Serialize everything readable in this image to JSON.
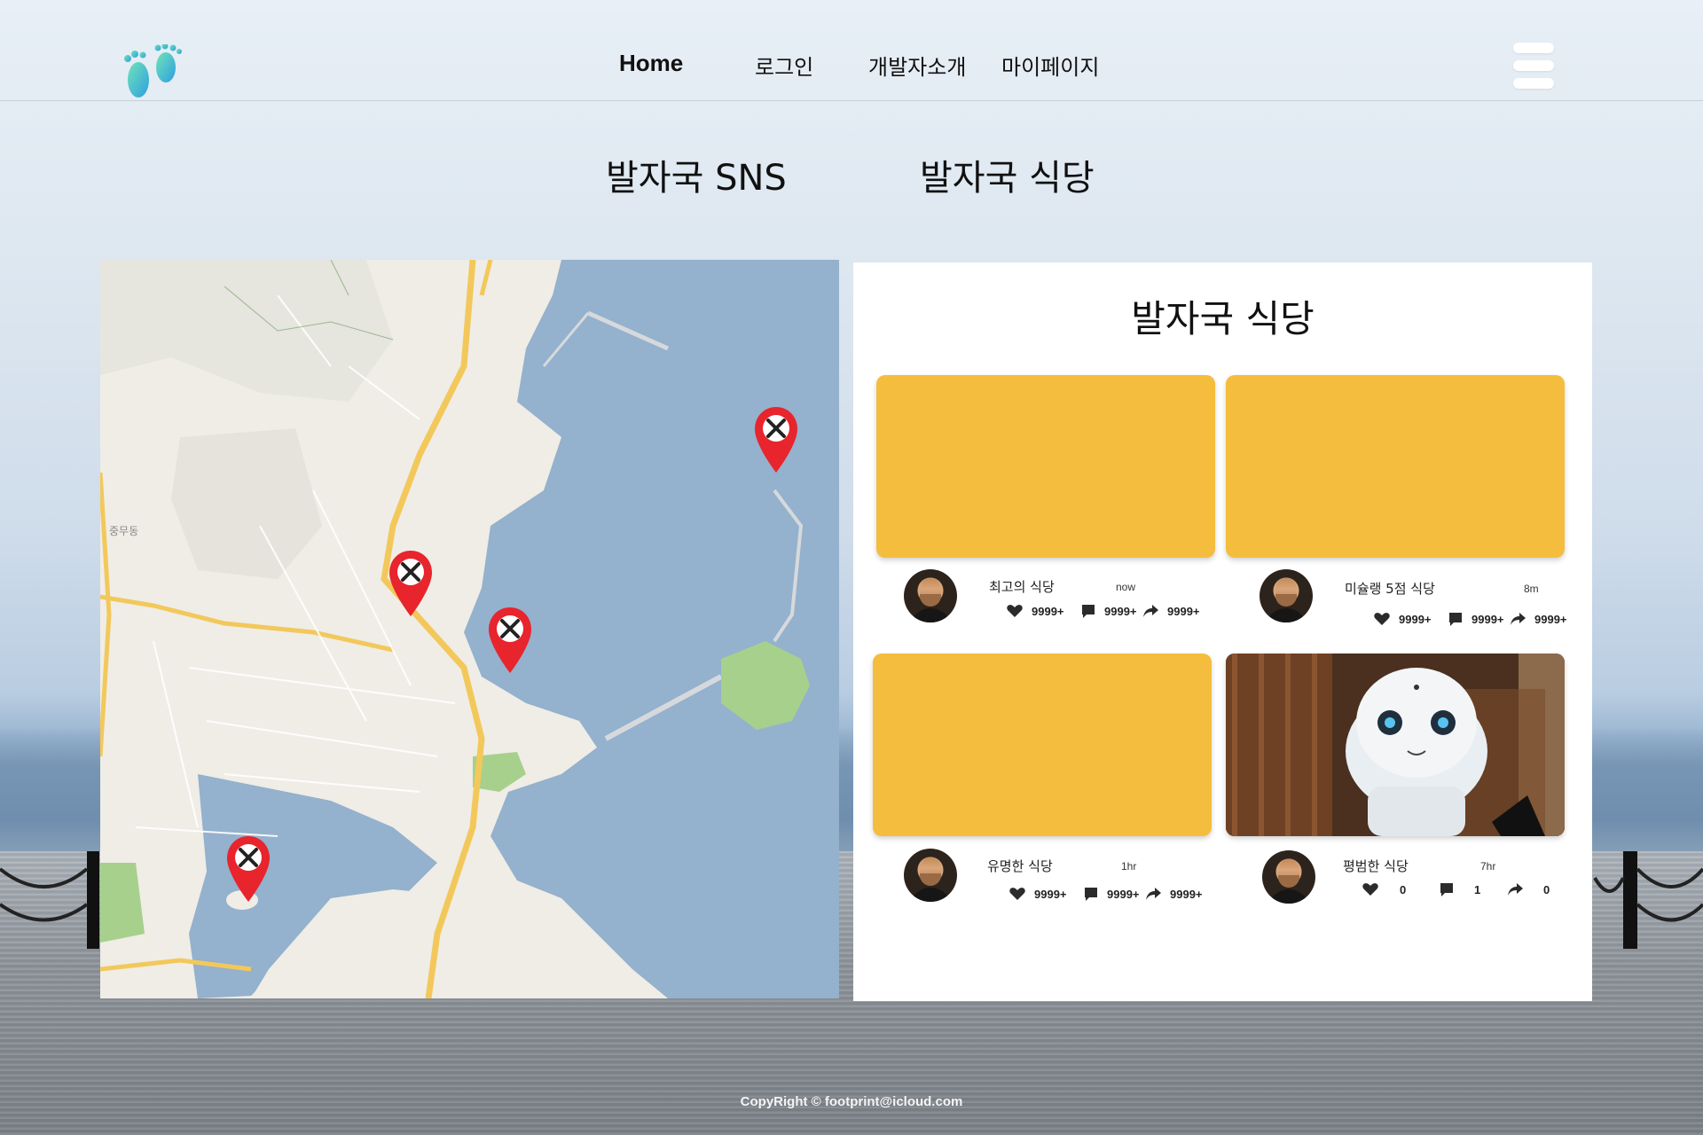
{
  "nav": {
    "home": "Home",
    "login": "로그인",
    "developer": "개발자소개",
    "mypage": "마이페이지"
  },
  "sections": {
    "sns": "발자국 SNS",
    "restaurant": "발자국 식당"
  },
  "panel": {
    "title": "발자국 식당",
    "cards": [
      {
        "name": "최고의 식당",
        "time": "now",
        "likes": "9999+",
        "comments": "9999+",
        "shares": "9999+"
      },
      {
        "name": "미슐랭 5점 식당",
        "time": "8m",
        "likes": "9999+",
        "comments": "9999+",
        "shares": "9999+"
      },
      {
        "name": "유명한 식당",
        "time": "1hr",
        "likes": "9999+",
        "comments": "9999+",
        "shares": "9999+"
      },
      {
        "name": "평범한 식당",
        "time": "7hr",
        "likes": "0",
        "comments": "1",
        "shares": "0"
      }
    ]
  },
  "map": {
    "marker_icon": "restaurant-pin-icon",
    "marker_color": "#e8242d",
    "labels": [
      "중무동"
    ]
  },
  "colors": {
    "thumbnail": "#f5bd3d",
    "sea": "#94b1cd",
    "marker": "#e8242d"
  },
  "footer": "CopyRight © footprint@icloud.com"
}
